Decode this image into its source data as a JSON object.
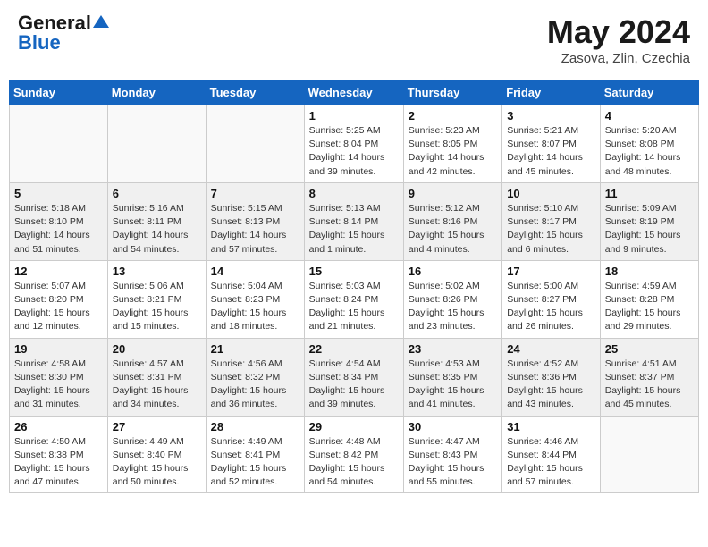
{
  "header": {
    "logo_general": "General",
    "logo_blue": "Blue",
    "month": "May 2024",
    "location": "Zasova, Zlin, Czechia"
  },
  "weekdays": [
    "Sunday",
    "Monday",
    "Tuesday",
    "Wednesday",
    "Thursday",
    "Friday",
    "Saturday"
  ],
  "weeks": [
    [
      {
        "num": "",
        "info": ""
      },
      {
        "num": "",
        "info": ""
      },
      {
        "num": "",
        "info": ""
      },
      {
        "num": "1",
        "info": "Sunrise: 5:25 AM\nSunset: 8:04 PM\nDaylight: 14 hours and 39 minutes."
      },
      {
        "num": "2",
        "info": "Sunrise: 5:23 AM\nSunset: 8:05 PM\nDaylight: 14 hours and 42 minutes."
      },
      {
        "num": "3",
        "info": "Sunrise: 5:21 AM\nSunset: 8:07 PM\nDaylight: 14 hours and 45 minutes."
      },
      {
        "num": "4",
        "info": "Sunrise: 5:20 AM\nSunset: 8:08 PM\nDaylight: 14 hours and 48 minutes."
      }
    ],
    [
      {
        "num": "5",
        "info": "Sunrise: 5:18 AM\nSunset: 8:10 PM\nDaylight: 14 hours and 51 minutes."
      },
      {
        "num": "6",
        "info": "Sunrise: 5:16 AM\nSunset: 8:11 PM\nDaylight: 14 hours and 54 minutes."
      },
      {
        "num": "7",
        "info": "Sunrise: 5:15 AM\nSunset: 8:13 PM\nDaylight: 14 hours and 57 minutes."
      },
      {
        "num": "8",
        "info": "Sunrise: 5:13 AM\nSunset: 8:14 PM\nDaylight: 15 hours and 1 minute."
      },
      {
        "num": "9",
        "info": "Sunrise: 5:12 AM\nSunset: 8:16 PM\nDaylight: 15 hours and 4 minutes."
      },
      {
        "num": "10",
        "info": "Sunrise: 5:10 AM\nSunset: 8:17 PM\nDaylight: 15 hours and 6 minutes."
      },
      {
        "num": "11",
        "info": "Sunrise: 5:09 AM\nSunset: 8:19 PM\nDaylight: 15 hours and 9 minutes."
      }
    ],
    [
      {
        "num": "12",
        "info": "Sunrise: 5:07 AM\nSunset: 8:20 PM\nDaylight: 15 hours and 12 minutes."
      },
      {
        "num": "13",
        "info": "Sunrise: 5:06 AM\nSunset: 8:21 PM\nDaylight: 15 hours and 15 minutes."
      },
      {
        "num": "14",
        "info": "Sunrise: 5:04 AM\nSunset: 8:23 PM\nDaylight: 15 hours and 18 minutes."
      },
      {
        "num": "15",
        "info": "Sunrise: 5:03 AM\nSunset: 8:24 PM\nDaylight: 15 hours and 21 minutes."
      },
      {
        "num": "16",
        "info": "Sunrise: 5:02 AM\nSunset: 8:26 PM\nDaylight: 15 hours and 23 minutes."
      },
      {
        "num": "17",
        "info": "Sunrise: 5:00 AM\nSunset: 8:27 PM\nDaylight: 15 hours and 26 minutes."
      },
      {
        "num": "18",
        "info": "Sunrise: 4:59 AM\nSunset: 8:28 PM\nDaylight: 15 hours and 29 minutes."
      }
    ],
    [
      {
        "num": "19",
        "info": "Sunrise: 4:58 AM\nSunset: 8:30 PM\nDaylight: 15 hours and 31 minutes."
      },
      {
        "num": "20",
        "info": "Sunrise: 4:57 AM\nSunset: 8:31 PM\nDaylight: 15 hours and 34 minutes."
      },
      {
        "num": "21",
        "info": "Sunrise: 4:56 AM\nSunset: 8:32 PM\nDaylight: 15 hours and 36 minutes."
      },
      {
        "num": "22",
        "info": "Sunrise: 4:54 AM\nSunset: 8:34 PM\nDaylight: 15 hours and 39 minutes."
      },
      {
        "num": "23",
        "info": "Sunrise: 4:53 AM\nSunset: 8:35 PM\nDaylight: 15 hours and 41 minutes."
      },
      {
        "num": "24",
        "info": "Sunrise: 4:52 AM\nSunset: 8:36 PM\nDaylight: 15 hours and 43 minutes."
      },
      {
        "num": "25",
        "info": "Sunrise: 4:51 AM\nSunset: 8:37 PM\nDaylight: 15 hours and 45 minutes."
      }
    ],
    [
      {
        "num": "26",
        "info": "Sunrise: 4:50 AM\nSunset: 8:38 PM\nDaylight: 15 hours and 47 minutes."
      },
      {
        "num": "27",
        "info": "Sunrise: 4:49 AM\nSunset: 8:40 PM\nDaylight: 15 hours and 50 minutes."
      },
      {
        "num": "28",
        "info": "Sunrise: 4:49 AM\nSunset: 8:41 PM\nDaylight: 15 hours and 52 minutes."
      },
      {
        "num": "29",
        "info": "Sunrise: 4:48 AM\nSunset: 8:42 PM\nDaylight: 15 hours and 54 minutes."
      },
      {
        "num": "30",
        "info": "Sunrise: 4:47 AM\nSunset: 8:43 PM\nDaylight: 15 hours and 55 minutes."
      },
      {
        "num": "31",
        "info": "Sunrise: 4:46 AM\nSunset: 8:44 PM\nDaylight: 15 hours and 57 minutes."
      },
      {
        "num": "",
        "info": ""
      }
    ]
  ]
}
